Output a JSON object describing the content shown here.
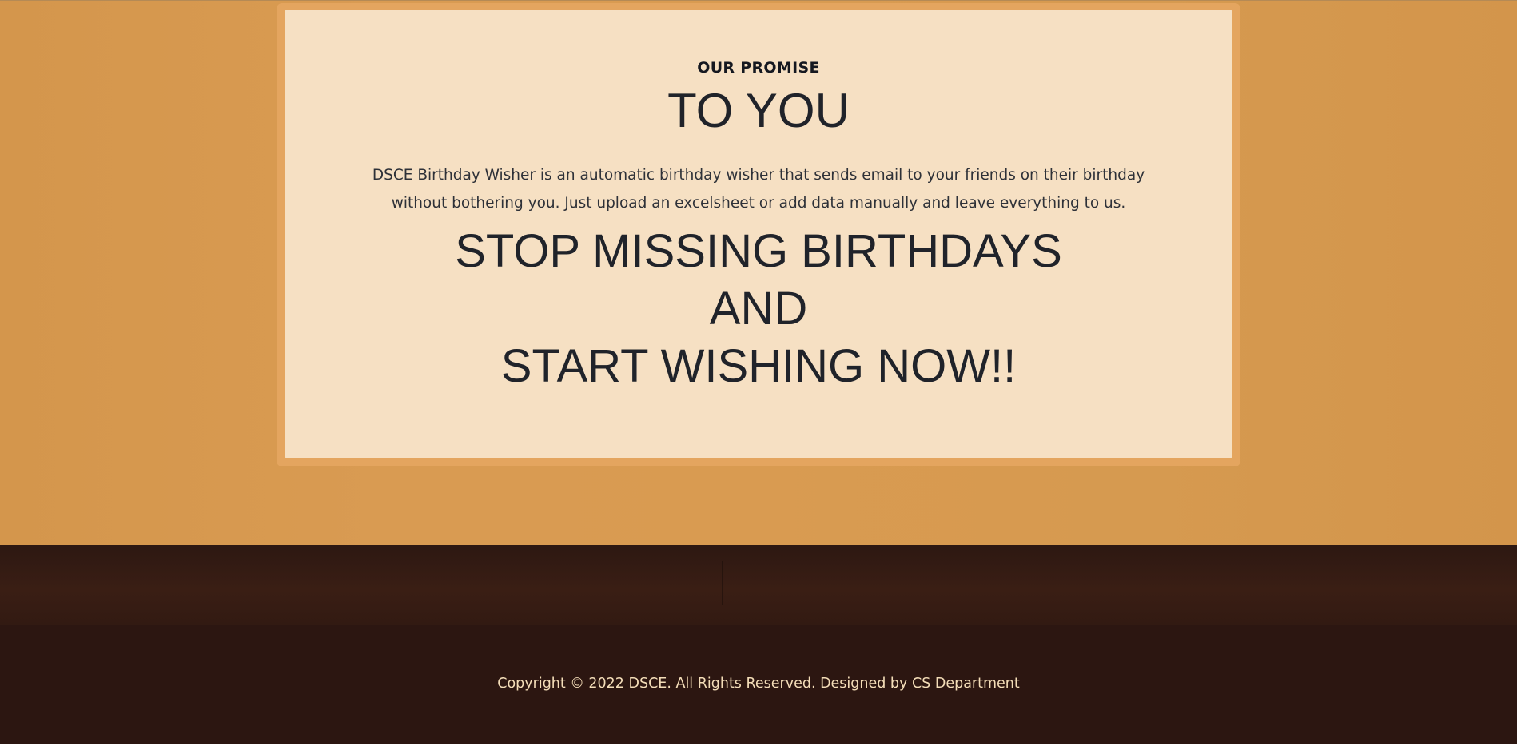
{
  "promise": {
    "eyebrow": "OUR PROMISE",
    "title": "TO YOU",
    "description": "DSCE Birthday Wisher is an automatic birthday wisher that sends email to your friends on their birthday without bothering you. Just upload an excelsheet or add data manually and leave everything to us.",
    "slogan_line_1": "STOP MISSING BIRTHDAYS",
    "slogan_line_2": "AND",
    "slogan_line_3": "START WISHING NOW!!"
  },
  "footer": {
    "copyright": "Copyright © 2022 DSCE. All Rights Reserved. Designed by CS Department"
  },
  "colors": {
    "page_background": "#d99b51",
    "card_frame": "#e4a55f",
    "card_background": "#f6e0c3",
    "footer_background": "#2c1611",
    "footer_text": "#f4ddb8"
  }
}
